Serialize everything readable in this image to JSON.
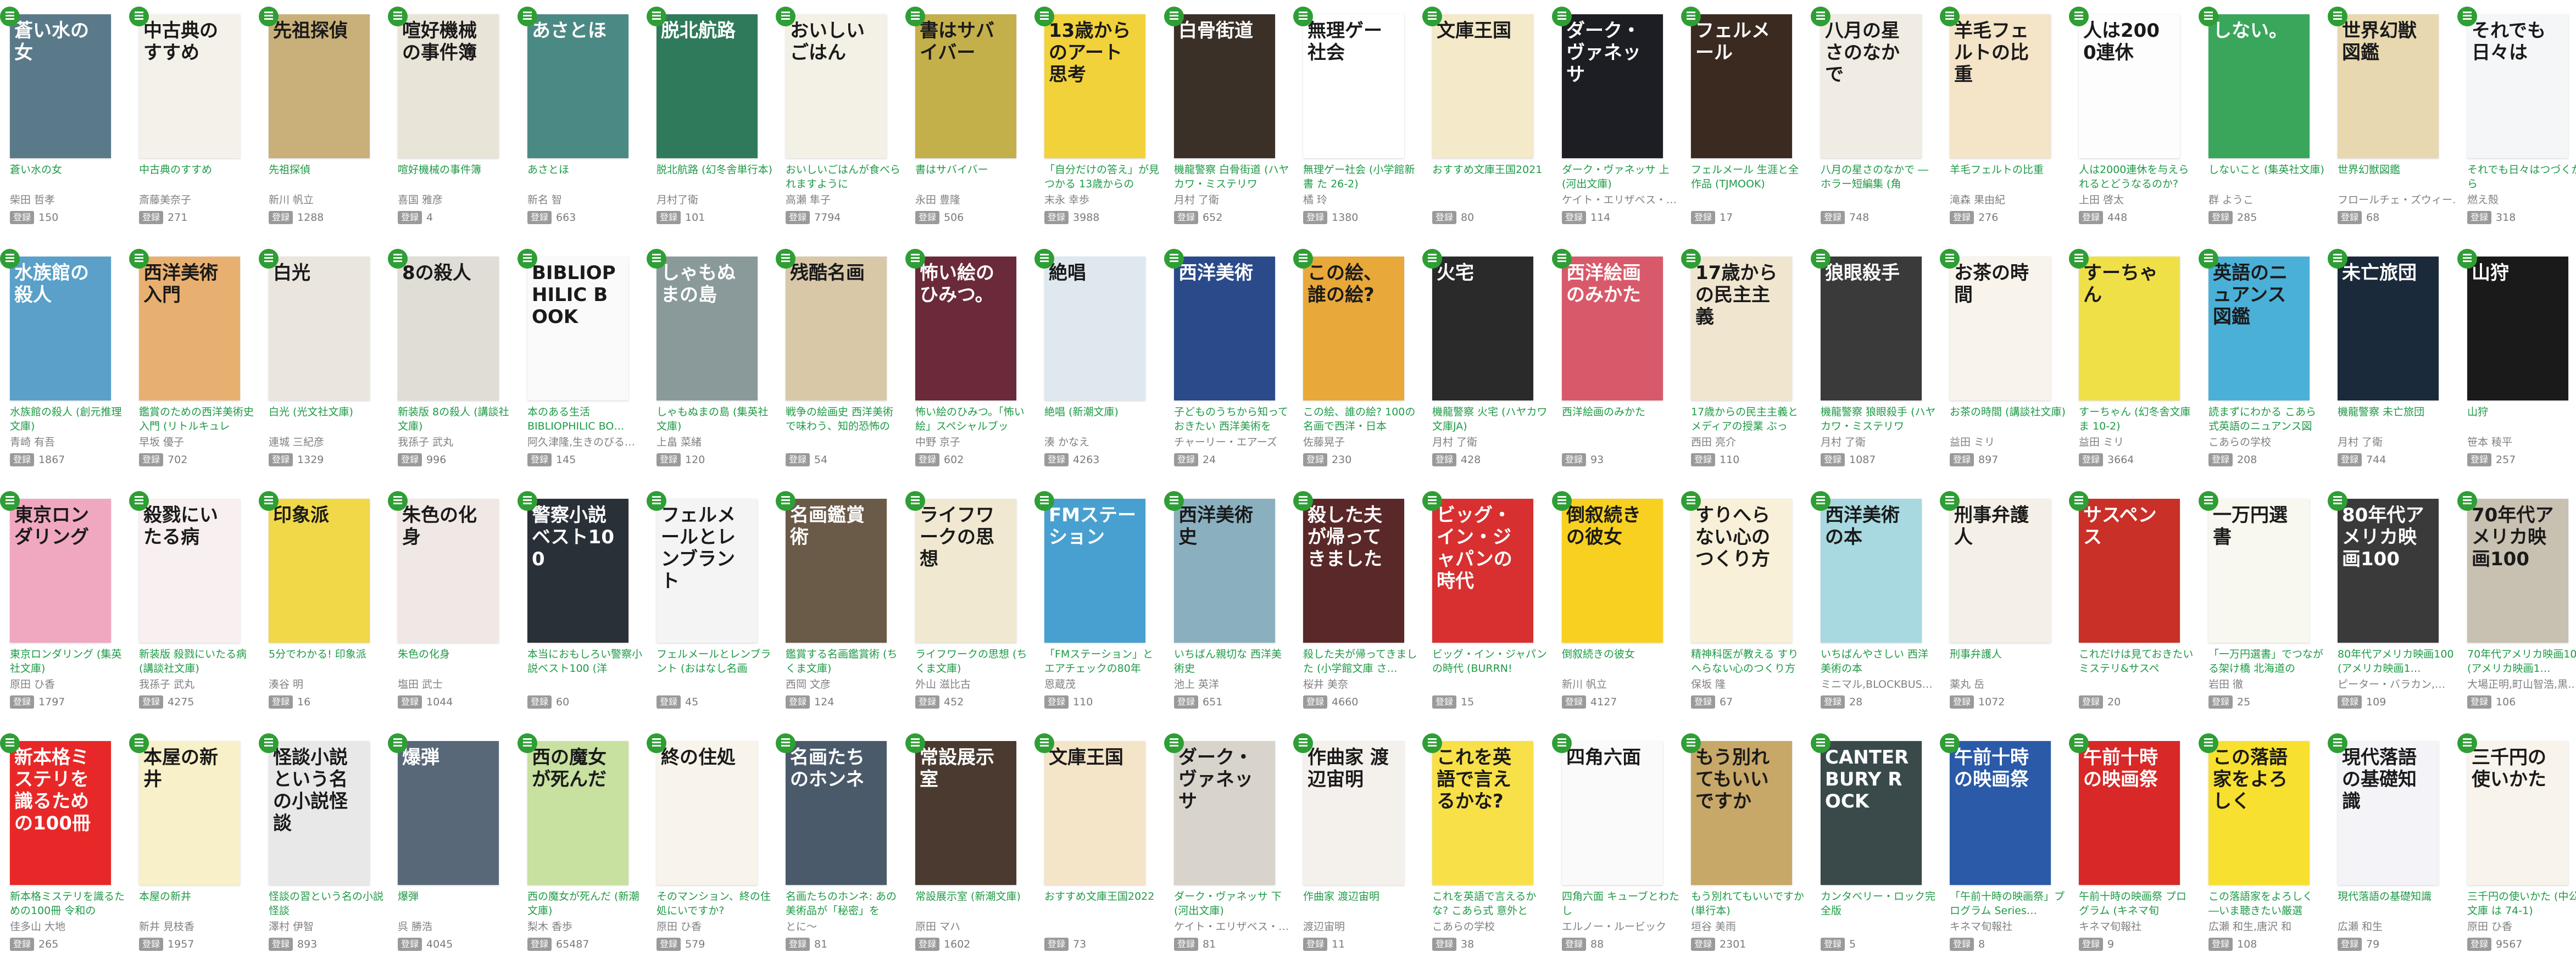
{
  "badge_label": "登録",
  "books": [
    {
      "title": "蒼い水の女",
      "author": "柴田 哲孝",
      "count": "150",
      "cover_color": "#5a7a8a",
      "cover_text": "蒼い水の女"
    },
    {
      "title": "中古典のすすめ",
      "author": "斎藤美奈子",
      "count": "271",
      "cover_color": "#f4f1ea",
      "cover_text": "中古典のすすめ"
    },
    {
      "title": "先祖探偵",
      "author": "新川 帆立",
      "count": "1288",
      "cover_color": "#c9b07a",
      "cover_text": "先祖探偵"
    },
    {
      "title": "喧好機械の事件簿",
      "author": "喜国 雅彦",
      "count": "4",
      "cover_color": "#e9e4d8",
      "cover_text": "喧好機械の事件簿"
    },
    {
      "title": "あさとほ",
      "author": "新名 智",
      "count": "663",
      "cover_color": "#4b8a84",
      "cover_text": "あさとほ"
    },
    {
      "title": "脱北航路 (幻冬舎単行本)",
      "author": "月村了衛",
      "count": "101",
      "cover_color": "#2f7a5a",
      "cover_text": "脱北航路"
    },
    {
      "title": "おいしいごはんが食べられますように",
      "author": "高瀬 隼子",
      "count": "7794",
      "cover_color": "#f3f0e6",
      "cover_text": "おいしいごはん"
    },
    {
      "title": "書はサバイバー",
      "author": "永田 豊隆",
      "count": "506",
      "cover_color": "#c4b04a",
      "cover_text": "書はサバイバー"
    },
    {
      "title": "「自分だけの答え」が見つかる 13歳からの",
      "author": "末永 幸歩",
      "count": "3988",
      "cover_color": "#f2d23a",
      "cover_text": "13歳からのアート思考"
    },
    {
      "title": "機龍警察 白骨街道 (ハヤカワ・ミステリワ",
      "author": "月村 了衛",
      "count": "652",
      "cover_color": "#3a3028",
      "cover_text": "白骨街道"
    },
    {
      "title": "無理ゲー社会 (小学館新書 た 26-2)",
      "author": "橘 玲",
      "count": "1380",
      "cover_color": "#ffffff",
      "cover_text": "無理ゲー社会"
    },
    {
      "title": "おすすめ文庫王国2021",
      "author": "",
      "count": "80",
      "cover_color": "#f4e9c8",
      "cover_text": "文庫王国"
    },
    {
      "title": "ダーク・ヴァネッサ 上 (河出文庫)",
      "author": "ケイト・エリザベス・…",
      "count": "114",
      "cover_color": "#1d1d24",
      "cover_text": "ダーク・ヴァネッサ"
    },
    {
      "title": "フェルメール 生涯と全作品 (TJMOOK)",
      "author": "",
      "count": "17",
      "cover_color": "#3a2a20",
      "cover_text": "フェルメール"
    },
    {
      "title": "八月の星さのなかで ―ホラー短編集 (角",
      "author": "",
      "count": "748",
      "cover_color": "#f0ece4",
      "cover_text": "八月の星さのなかで"
    },
    {
      "title": "羊毛フェルトの比重",
      "author": "滝森 果由紀",
      "count": "276",
      "cover_color": "#f4e4c8",
      "cover_text": "羊毛フェルトの比重"
    },
    {
      "title": "人は2000連休を与えられるとどうなるのか?",
      "author": "上田 啓太",
      "count": "448",
      "cover_color": "#fdfdfd",
      "cover_text": "人は2000連休"
    },
    {
      "title": "しないこと (集英社文庫)",
      "author": "群 ようこ",
      "count": "285",
      "cover_color": "#3aa65c",
      "cover_text": "しない。"
    },
    {
      "title": "世界幻獣図鑑",
      "author": "フロールチェ・ズウィー…",
      "count": "68",
      "cover_color": "#e8d8b0",
      "cover_text": "世界幻獣図鑑"
    },
    {
      "title": "それでも日々はつづくから",
      "author": "燃え殻",
      "count": "318",
      "cover_color": "#f4f6f8",
      "cover_text": "それでも日々は"
    },
    {
      "title": "水族館の殺人 (創元推理文庫)",
      "author": "青崎 有吾",
      "count": "1867",
      "cover_color": "#5aa0c8",
      "cover_text": "水族館の殺人"
    },
    {
      "title": "鑑賞のための西洋美術史入門 (リトルキュレ",
      "author": "早坂 優子",
      "count": "702",
      "cover_color": "#e8b070",
      "cover_text": "西洋美術入門"
    },
    {
      "title": "白光 (光文社文庫)",
      "author": "連城 三紀彦",
      "count": "1329",
      "cover_color": "#eae6de",
      "cover_text": "白光"
    },
    {
      "title": "新装版 8の殺人 (講談社文庫)",
      "author": "我孫子 武丸",
      "count": "996",
      "cover_color": "#e0dcd6",
      "cover_text": "8の殺人"
    },
    {
      "title": "本のある生活 BIBLIOPHILIC BO…",
      "author": "阿久津隆,生きのびる…",
      "count": "145",
      "cover_color": "#fafafa",
      "cover_text": "BIBLIOPHILIC BOOK"
    },
    {
      "title": "しゃもぬまの島 (集英社文庫)",
      "author": "上畠 菜緒",
      "count": "120",
      "cover_color": "#8a9a9a",
      "cover_text": "しゃもぬまの島"
    },
    {
      "title": "戦争の絵画史 西洋美術で味わう、知的恐怖の",
      "author": "",
      "count": "54",
      "cover_color": "#d8c8a8",
      "cover_text": "残酷名画"
    },
    {
      "title": "怖い絵のひみつ。「怖い絵」スペシャルブッ",
      "author": "中野 京子",
      "count": "602",
      "cover_color": "#6a2a3a",
      "cover_text": "怖い絵のひみつ。"
    },
    {
      "title": "絶唱 (新潮文庫)",
      "author": "湊 かなえ",
      "count": "4263",
      "cover_color": "#dfe8ee",
      "cover_text": "絶唱"
    },
    {
      "title": "子どものうちから知っておきたい 西洋美術を",
      "author": "チャーリー・エアーズ",
      "count": "24",
      "cover_color": "#2a4a8a",
      "cover_text": "西洋美術"
    },
    {
      "title": "この絵、誰の絵? 100の名画で西洋・日本",
      "author": "佐藤晃子",
      "count": "230",
      "cover_color": "#e8a83a",
      "cover_text": "この絵、誰の絵?"
    },
    {
      "title": "機龍警察 火宅 (ハヤカワ文庫JA)",
      "author": "月村 了衛",
      "count": "428",
      "cover_color": "#2a2a2a",
      "cover_text": "火宅"
    },
    {
      "title": "西洋絵画のみかた",
      "author": "",
      "count": "93",
      "cover_color": "#d85a6a",
      "cover_text": "西洋絵画のみかた"
    },
    {
      "title": "17歳からの民主主義とメディアの授業 ぶっ",
      "author": "西田 亮介",
      "count": "110",
      "cover_color": "#f0e6d0",
      "cover_text": "17歳からの民主主義"
    },
    {
      "title": "機龍警察 狼眼殺手 (ハヤカワ・ミステリワ",
      "author": "月村 了衛",
      "count": "1087",
      "cover_color": "#3a3a3a",
      "cover_text": "狼眼殺手"
    },
    {
      "title": "お茶の時間 (講談社文庫)",
      "author": "益田 ミリ",
      "count": "897",
      "cover_color": "#f8f4ec",
      "cover_text": "お茶の時間"
    },
    {
      "title": "すーちゃん (幻冬舎文庫 ま 10-2)",
      "author": "益田 ミリ",
      "count": "3664",
      "cover_color": "#f0e048",
      "cover_text": "すーちゃん"
    },
    {
      "title": "読まずにわかる こあら式英語のニュアンス図",
      "author": "こあらの学校",
      "count": "208",
      "cover_color": "#4ab0d8",
      "cover_text": "英語のニュアンス図鑑"
    },
    {
      "title": "機龍警察 未亡旅団",
      "author": "月村 了衛",
      "count": "744",
      "cover_color": "#1a2a3a",
      "cover_text": "未亡旅団"
    },
    {
      "title": "山狩",
      "author": "笹本 稜平",
      "count": "257",
      "cover_color": "#1a1a1a",
      "cover_text": "山狩"
    },
    {
      "title": "東京ロンダリング (集英社文庫)",
      "author": "原田 ひ香",
      "count": "1797",
      "cover_color": "#f0a8c0",
      "cover_text": "東京ロンダリング"
    },
    {
      "title": "新装版 殺戮にいたる病 (講談社文庫)",
      "author": "我孫子 武丸",
      "count": "4275",
      "cover_color": "#f8f0f0",
      "cover_text": "殺戮にいたる病"
    },
    {
      "title": "5分でわかる! 印象派",
      "author": "湊谷 明",
      "count": "16",
      "cover_color": "#f0d848",
      "cover_text": "印象派"
    },
    {
      "title": "朱色の化身",
      "author": "塩田 武士",
      "count": "1044",
      "cover_color": "#f0e8e4",
      "cover_text": "朱色の化身"
    },
    {
      "title": "本当におもしろい警察小説ベスト100 (洋",
      "author": "",
      "count": "60",
      "cover_color": "#2a3038",
      "cover_text": "警察小説ベスト100"
    },
    {
      "title": "フェルメールとレンブラント (おはなし名画",
      "author": "",
      "count": "45",
      "cover_color": "#f4f4f4",
      "cover_text": "フェルメールとレンブラント"
    },
    {
      "title": "鑑賞する名画鑑賞術 (ちくま文庫)",
      "author": "西岡 文彦",
      "count": "124",
      "cover_color": "#6a5a48",
      "cover_text": "名画鑑賞術"
    },
    {
      "title": "ライフワークの思想 (ちくま文庫)",
      "author": "外山 滋比古",
      "count": "452",
      "cover_color": "#f0e8d0",
      "cover_text": "ライフワークの思想"
    },
    {
      "title": "「FMステーション」とエアチェックの80年",
      "author": "恩蔵茂",
      "count": "110",
      "cover_color": "#48a0d0",
      "cover_text": "FMステーション"
    },
    {
      "title": "いちばん親切な 西洋美術史",
      "author": "池上 英洋",
      "count": "651",
      "cover_color": "#8ab0c0",
      "cover_text": "西洋美術史"
    },
    {
      "title": "殺した夫が帰ってきました (小学館文庫 さ…",
      "author": "桜井 美奈",
      "count": "4660",
      "cover_color": "#5a2828",
      "cover_text": "殺した夫が帰ってきました"
    },
    {
      "title": "ビッグ・イン・ジャパンの時代 (BURRN!",
      "author": "",
      "count": "15",
      "cover_color": "#d83030",
      "cover_text": "ビッグ・イン・ジャパンの時代"
    },
    {
      "title": "倒叙続きの彼女",
      "author": "新川 帆立",
      "count": "4127",
      "cover_color": "#f8d020",
      "cover_text": "倒叙続きの彼女"
    },
    {
      "title": "精神科医が教える すりへらない心のつくり方",
      "author": "保坂 隆",
      "count": "67",
      "cover_color": "#f8f0d8",
      "cover_text": "すりへらない心のつくり方"
    },
    {
      "title": "いちばんやさしい 西洋美術の本",
      "author": "ミニマル,BLOCKBUS…",
      "count": "28",
      "cover_color": "#a8d8e0",
      "cover_text": "西洋美術の本"
    },
    {
      "title": "刑事弁護人",
      "author": "薬丸 岳",
      "count": "1072",
      "cover_color": "#f4f0e8",
      "cover_text": "刑事弁護人"
    },
    {
      "title": "これだけは見ておきたい ミステリ&サスペ",
      "author": "",
      "count": "20",
      "cover_color": "#c83028",
      "cover_text": "サスペンス"
    },
    {
      "title": "「一万円選書」でつながる架け橋 北海道の",
      "author": "岩田 徹",
      "count": "25",
      "cover_color": "#f8f8f0",
      "cover_text": "一万円選書"
    },
    {
      "title": "80年代アメリカ映画100 (アメリカ映画1…",
      "author": "ピーター・バラカン,…",
      "count": "109",
      "cover_color": "#3a3a3a",
      "cover_text": "80年代アメリカ映画100"
    },
    {
      "title": "70年代アメリカ映画100 (アメリカ映画1…",
      "author": "大場正明,町山智浩,黒…",
      "count": "106",
      "cover_color": "#c8c0b0",
      "cover_text": "70年代アメリカ映画100"
    },
    {
      "title": "新本格ミステリを識るための100冊 令和の",
      "author": "佳多山 大地",
      "count": "265",
      "cover_color": "#e82828",
      "cover_text": "新本格ミステリを識るための100冊"
    },
    {
      "title": "本屋の新井",
      "author": "新井 見枝香",
      "count": "1957",
      "cover_color": "#f8f0c8",
      "cover_text": "本屋の新井"
    },
    {
      "title": "怪談の習という名の小説怪談",
      "author": "澤村 伊智",
      "count": "893",
      "cover_color": "#e8e8e8",
      "cover_text": "怪談小説という名の小説怪談"
    },
    {
      "title": "爆弾",
      "author": "呉 勝浩",
      "count": "4045",
      "cover_color": "#586878",
      "cover_text": "爆弾"
    },
    {
      "title": "西の魔女が死んだ (新潮文庫)",
      "author": "梨木 香歩",
      "count": "65487",
      "cover_color": "#c8e0a0",
      "cover_text": "西の魔女が死んだ"
    },
    {
      "title": "そのマンション、終の住処にいですか?",
      "author": "原田 ひ香",
      "count": "579",
      "cover_color": "#f8f4ec",
      "cover_text": "終の住処"
    },
    {
      "title": "名画たちのホンネ: あの美術品が「秘密」を",
      "author": "とに〜",
      "count": "81",
      "cover_color": "#4a5a6a",
      "cover_text": "名画たちのホンネ"
    },
    {
      "title": "常設展示室 (新潮文庫)",
      "author": "原田 マハ",
      "count": "1602",
      "cover_color": "#4a3a30",
      "cover_text": "常設展示室"
    },
    {
      "title": "おすすめ文庫王国2022",
      "author": "",
      "count": "73",
      "cover_color": "#f4e4c8",
      "cover_text": "文庫王国"
    },
    {
      "title": "ダーク・ヴァネッサ 下 (河出文庫)",
      "author": "ケイト・エリザベス・…",
      "count": "81",
      "cover_color": "#d8d4cc",
      "cover_text": "ダーク・ヴァネッサ"
    },
    {
      "title": "作曲家 渡辺宙明",
      "author": "渡辺宙明",
      "count": "11",
      "cover_color": "#f4f0ec",
      "cover_text": "作曲家 渡辺宙明"
    },
    {
      "title": "これを英語で言えるかな? こあら式 意外と",
      "author": "こあらの学校",
      "count": "38",
      "cover_color": "#f8e048",
      "cover_text": "これを英語で言えるかな?"
    },
    {
      "title": "四角六面 キューブとわたし",
      "author": "エルノー・ルービック",
      "count": "88",
      "cover_color": "#fafafa",
      "cover_text": "四角六面"
    },
    {
      "title": "もう別れてもいいですか (単行本)",
      "author": "垣谷 美雨",
      "count": "2301",
      "cover_color": "#c8a868",
      "cover_text": "もう別れてもいいですか"
    },
    {
      "title": "カンタベリー・ロック完全版",
      "author": "",
      "count": "5",
      "cover_color": "#3a4a4a",
      "cover_text": "CANTERBURY ROCK"
    },
    {
      "title": "「午前十時の映画祭」プログラム Series…",
      "author": "キネマ旬報社",
      "count": "8",
      "cover_color": "#2a5aa8",
      "cover_text": "午前十時の映画祭"
    },
    {
      "title": "午前十時の映画祭 プログラム (キネマ旬",
      "author": "キネマ旬報社",
      "count": "9",
      "cover_color": "#d82828",
      "cover_text": "午前十時の映画祭"
    },
    {
      "title": "この落語家をよろしく ―いま聴きたい厳選",
      "author": "広瀬 和生,唐沢 和",
      "count": "108",
      "cover_color": "#f8e030",
      "cover_text": "この落語家をよろしく"
    },
    {
      "title": "現代落語の基礎知識",
      "author": "広瀬 和生",
      "count": "79",
      "cover_color": "#f4f4f8",
      "cover_text": "現代落語の基礎知識"
    },
    {
      "title": "三千円の使いかた (中公文庫 は 74-1)",
      "author": "原田 ひ香",
      "count": "9567",
      "cover_color": "#f8f4ec",
      "cover_text": "三千円の使いかた"
    }
  ]
}
